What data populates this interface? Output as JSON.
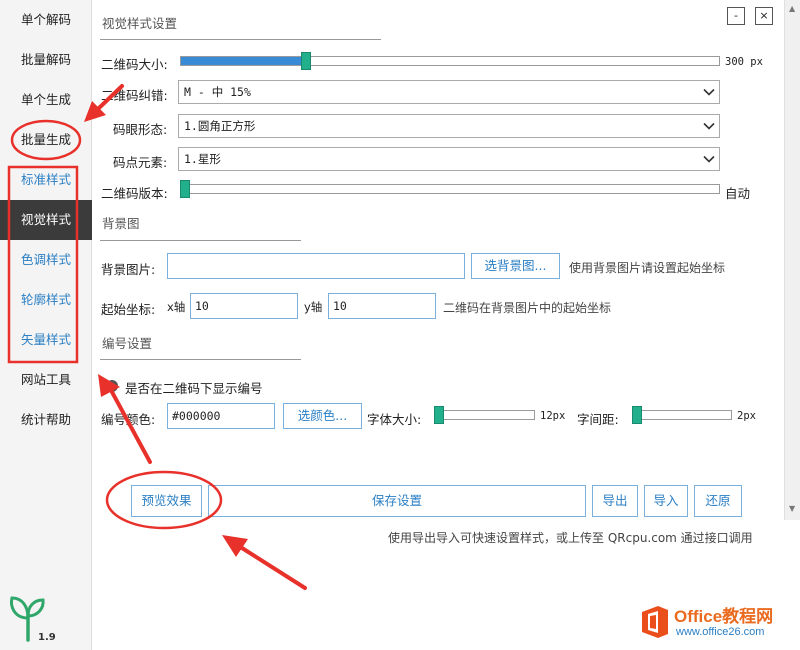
{
  "sidebar": {
    "items": [
      {
        "label": "单个解码"
      },
      {
        "label": "批量解码"
      },
      {
        "label": "单个生成"
      },
      {
        "label": "批量生成"
      },
      {
        "label": "标准样式"
      },
      {
        "label": "视觉样式"
      },
      {
        "label": "色调样式"
      },
      {
        "label": "轮廓样式"
      },
      {
        "label": "矢量样式"
      },
      {
        "label": "网站工具"
      },
      {
        "label": "统计帮助"
      }
    ],
    "version": "1.9"
  },
  "window": {
    "minimize": "-",
    "close": "×"
  },
  "visual": {
    "title": "视觉样式设置",
    "size_label": "二维码大小:",
    "size_value": "300 px",
    "size_fraction": 0.23,
    "ecc_label": "二维码纠错:",
    "ecc_value": "M  - 中 15%",
    "eye_label": "码眼形态:",
    "eye_value": "1.圆角正方形",
    "dot_label": "码点元素:",
    "dot_value": "1.星形",
    "version_label": "二维码版本:",
    "version_value": "自动",
    "version_fraction": 0.0
  },
  "background": {
    "title": "背景图",
    "image_label": "背景图片:",
    "image_value": "",
    "choose_button": "选背景图...",
    "image_hint": "使用背景图片请设置起始坐标",
    "start_label": "起始坐标:",
    "x_label": "x轴",
    "x_value": "10",
    "y_label": "y轴",
    "y_value": "10",
    "start_hint": "二维码在背景图片中的起始坐标"
  },
  "numbering": {
    "title": "编号设置",
    "show_label": "是否在二维码下显示编号",
    "color_label": "编号颜色:",
    "color_value": "#000000",
    "color_button": "选颜色...",
    "font_size_label": "字体大小:",
    "font_size_value": "12px",
    "font_size_fraction": 0.0,
    "spacing_label": "字间距:",
    "spacing_value": "2px",
    "spacing_fraction": 0.0
  },
  "actions": {
    "preview": "预览效果",
    "save": "保存设置",
    "export": "导出",
    "import": "导入",
    "restore": "还原",
    "hint": "使用导出导入可快速设置样式，或上传至 QRcpu.com 通过接口调用"
  },
  "watermark": {
    "brand": "Office教程网",
    "url": "www.office26.com"
  },
  "colors": {
    "accent": "#2b7fc4",
    "slider_fill": "#3a8bd6",
    "thumb": "#22b08c",
    "active_bg": "#3b3b3b",
    "annotation": "#e8312a"
  }
}
